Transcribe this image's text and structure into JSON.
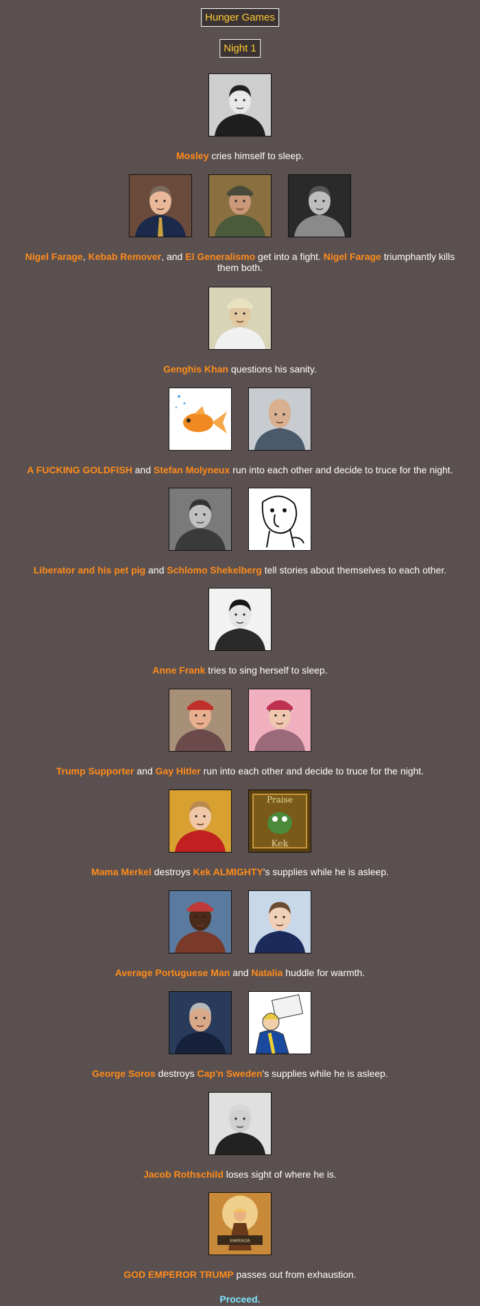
{
  "header": {
    "title": "Hunger Games",
    "subtitle": "Night 1"
  },
  "events": [
    {
      "images": [
        "mosley-portrait"
      ],
      "parts": [
        {
          "t": "Mosley",
          "n": true
        },
        {
          "t": " cries himself to sleep."
        }
      ]
    },
    {
      "images": [
        "nigel-farage-portrait",
        "kebab-remover-portrait",
        "el-generalismo-portrait"
      ],
      "parts": [
        {
          "t": "Nigel Farage",
          "n": true
        },
        {
          "t": ", "
        },
        {
          "t": "Kebab Remover",
          "n": true
        },
        {
          "t": ", and "
        },
        {
          "t": "El Generalismo",
          "n": true
        },
        {
          "t": " get into a fight. "
        },
        {
          "t": "Nigel Farage",
          "n": true
        },
        {
          "t": " triumphantly kills them both."
        }
      ]
    },
    {
      "images": [
        "genghis-khan-portrait"
      ],
      "parts": [
        {
          "t": "Genghis Khan",
          "n": true
        },
        {
          "t": " questions his sanity."
        }
      ]
    },
    {
      "images": [
        "goldfish-picture",
        "stefan-molyneux-portrait"
      ],
      "parts": [
        {
          "t": "A FUCKING GOLDFISH",
          "n": true
        },
        {
          "t": " and "
        },
        {
          "t": "Stefan Molyneux",
          "n": true
        },
        {
          "t": " run into each other and decide to truce for the night."
        }
      ]
    },
    {
      "images": [
        "liberator-and-pig-picture",
        "schlomo-shekelberg-drawing"
      ],
      "parts": [
        {
          "t": "Liberator and his pet pig",
          "n": true
        },
        {
          "t": " and "
        },
        {
          "t": "Schlomo Shekelberg",
          "n": true
        },
        {
          "t": " tell stories about themselves to each other."
        }
      ]
    },
    {
      "images": [
        "anne-frank-portrait"
      ],
      "parts": [
        {
          "t": "Anne Frank",
          "n": true
        },
        {
          "t": " tries to sing herself to sleep."
        }
      ]
    },
    {
      "images": [
        "trump-supporter-portrait",
        "gay-hitler-portrait"
      ],
      "parts": [
        {
          "t": "Trump Supporter",
          "n": true
        },
        {
          "t": " and "
        },
        {
          "t": "Gay Hitler",
          "n": true
        },
        {
          "t": " run into each other and decide to truce for the night."
        }
      ]
    },
    {
      "images": [
        "mama-merkel-portrait",
        "kek-almighty-picture"
      ],
      "parts": [
        {
          "t": "Mama Merkel",
          "n": true
        },
        {
          "t": " destroys "
        },
        {
          "t": "Kek ALMIGHTY",
          "n": true
        },
        {
          "t": "'s supplies while he is asleep."
        }
      ]
    },
    {
      "images": [
        "portuguese-man-portrait",
        "natalia-portrait"
      ],
      "parts": [
        {
          "t": "Average Portuguese Man",
          "n": true
        },
        {
          "t": " and "
        },
        {
          "t": "Natalia",
          "n": true
        },
        {
          "t": " huddle for warmth."
        }
      ]
    },
    {
      "images": [
        "george-soros-portrait",
        "capn-sweden-drawing"
      ],
      "parts": [
        {
          "t": "George Soros",
          "n": true
        },
        {
          "t": " destroys "
        },
        {
          "t": "Cap'n Sweden",
          "n": true
        },
        {
          "t": "'s supplies while he is asleep."
        }
      ]
    },
    {
      "images": [
        "jacob-rothschild-portrait"
      ],
      "parts": [
        {
          "t": "Jacob Rothschild",
          "n": true
        },
        {
          "t": " loses sight of where he is."
        }
      ]
    },
    {
      "images": [
        "god-emperor-trump-picture"
      ],
      "parts": [
        {
          "t": "GOD EMPEROR TRUMP",
          "n": true
        },
        {
          "t": " passes out from exhaustion."
        }
      ]
    }
  ],
  "proceed": {
    "label": "Proceed."
  },
  "colors": {
    "background": "#5b5050",
    "title_text": "#ffcc33",
    "name_text": "#ff8c1a",
    "body_text": "#ffffff",
    "proceed_link": "#7fe4ff"
  }
}
